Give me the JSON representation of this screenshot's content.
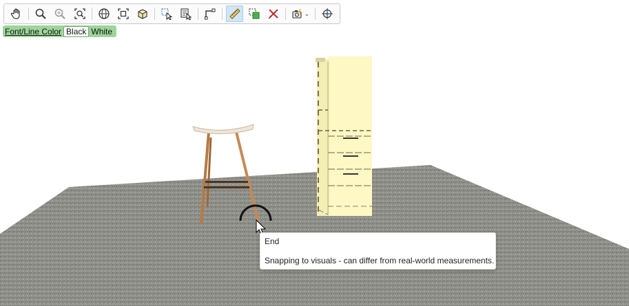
{
  "toolbar": {
    "items": [
      {
        "icon": "hand-pan-icon"
      },
      {
        "icon": "zoom-icon"
      },
      {
        "icon": "zoom-out-icon"
      },
      {
        "icon": "zoom-fit-icon"
      },
      {
        "icon": "orbit-icon"
      },
      {
        "icon": "zoom-extents-icon"
      },
      {
        "icon": "view-3d-box-icon"
      },
      {
        "icon": "select-icon"
      },
      {
        "icon": "select-list-icon"
      },
      {
        "icon": "measure-corner-icon"
      },
      {
        "icon": "ruler-icon",
        "active": true
      },
      {
        "icon": "layers-green-icon"
      },
      {
        "icon": "delete-x-icon"
      },
      {
        "icon": "camera-icon"
      },
      {
        "icon": "crosshair-icon"
      }
    ]
  },
  "color_bar": {
    "label": "Font/Line Color",
    "options": [
      "Black",
      "White"
    ],
    "selected": "Black"
  },
  "tooltip": {
    "title": "End",
    "message": "Snapping to visuals - can differ from real-world measurements."
  },
  "colors": {
    "floor": "#8e8e89",
    "cabinet": "#fdf8c4",
    "stool_seat": "#efe6d8",
    "stool_leg": "#c58a52",
    "active_button": "#cfe6f7",
    "color_bar": "#9dd59a"
  }
}
